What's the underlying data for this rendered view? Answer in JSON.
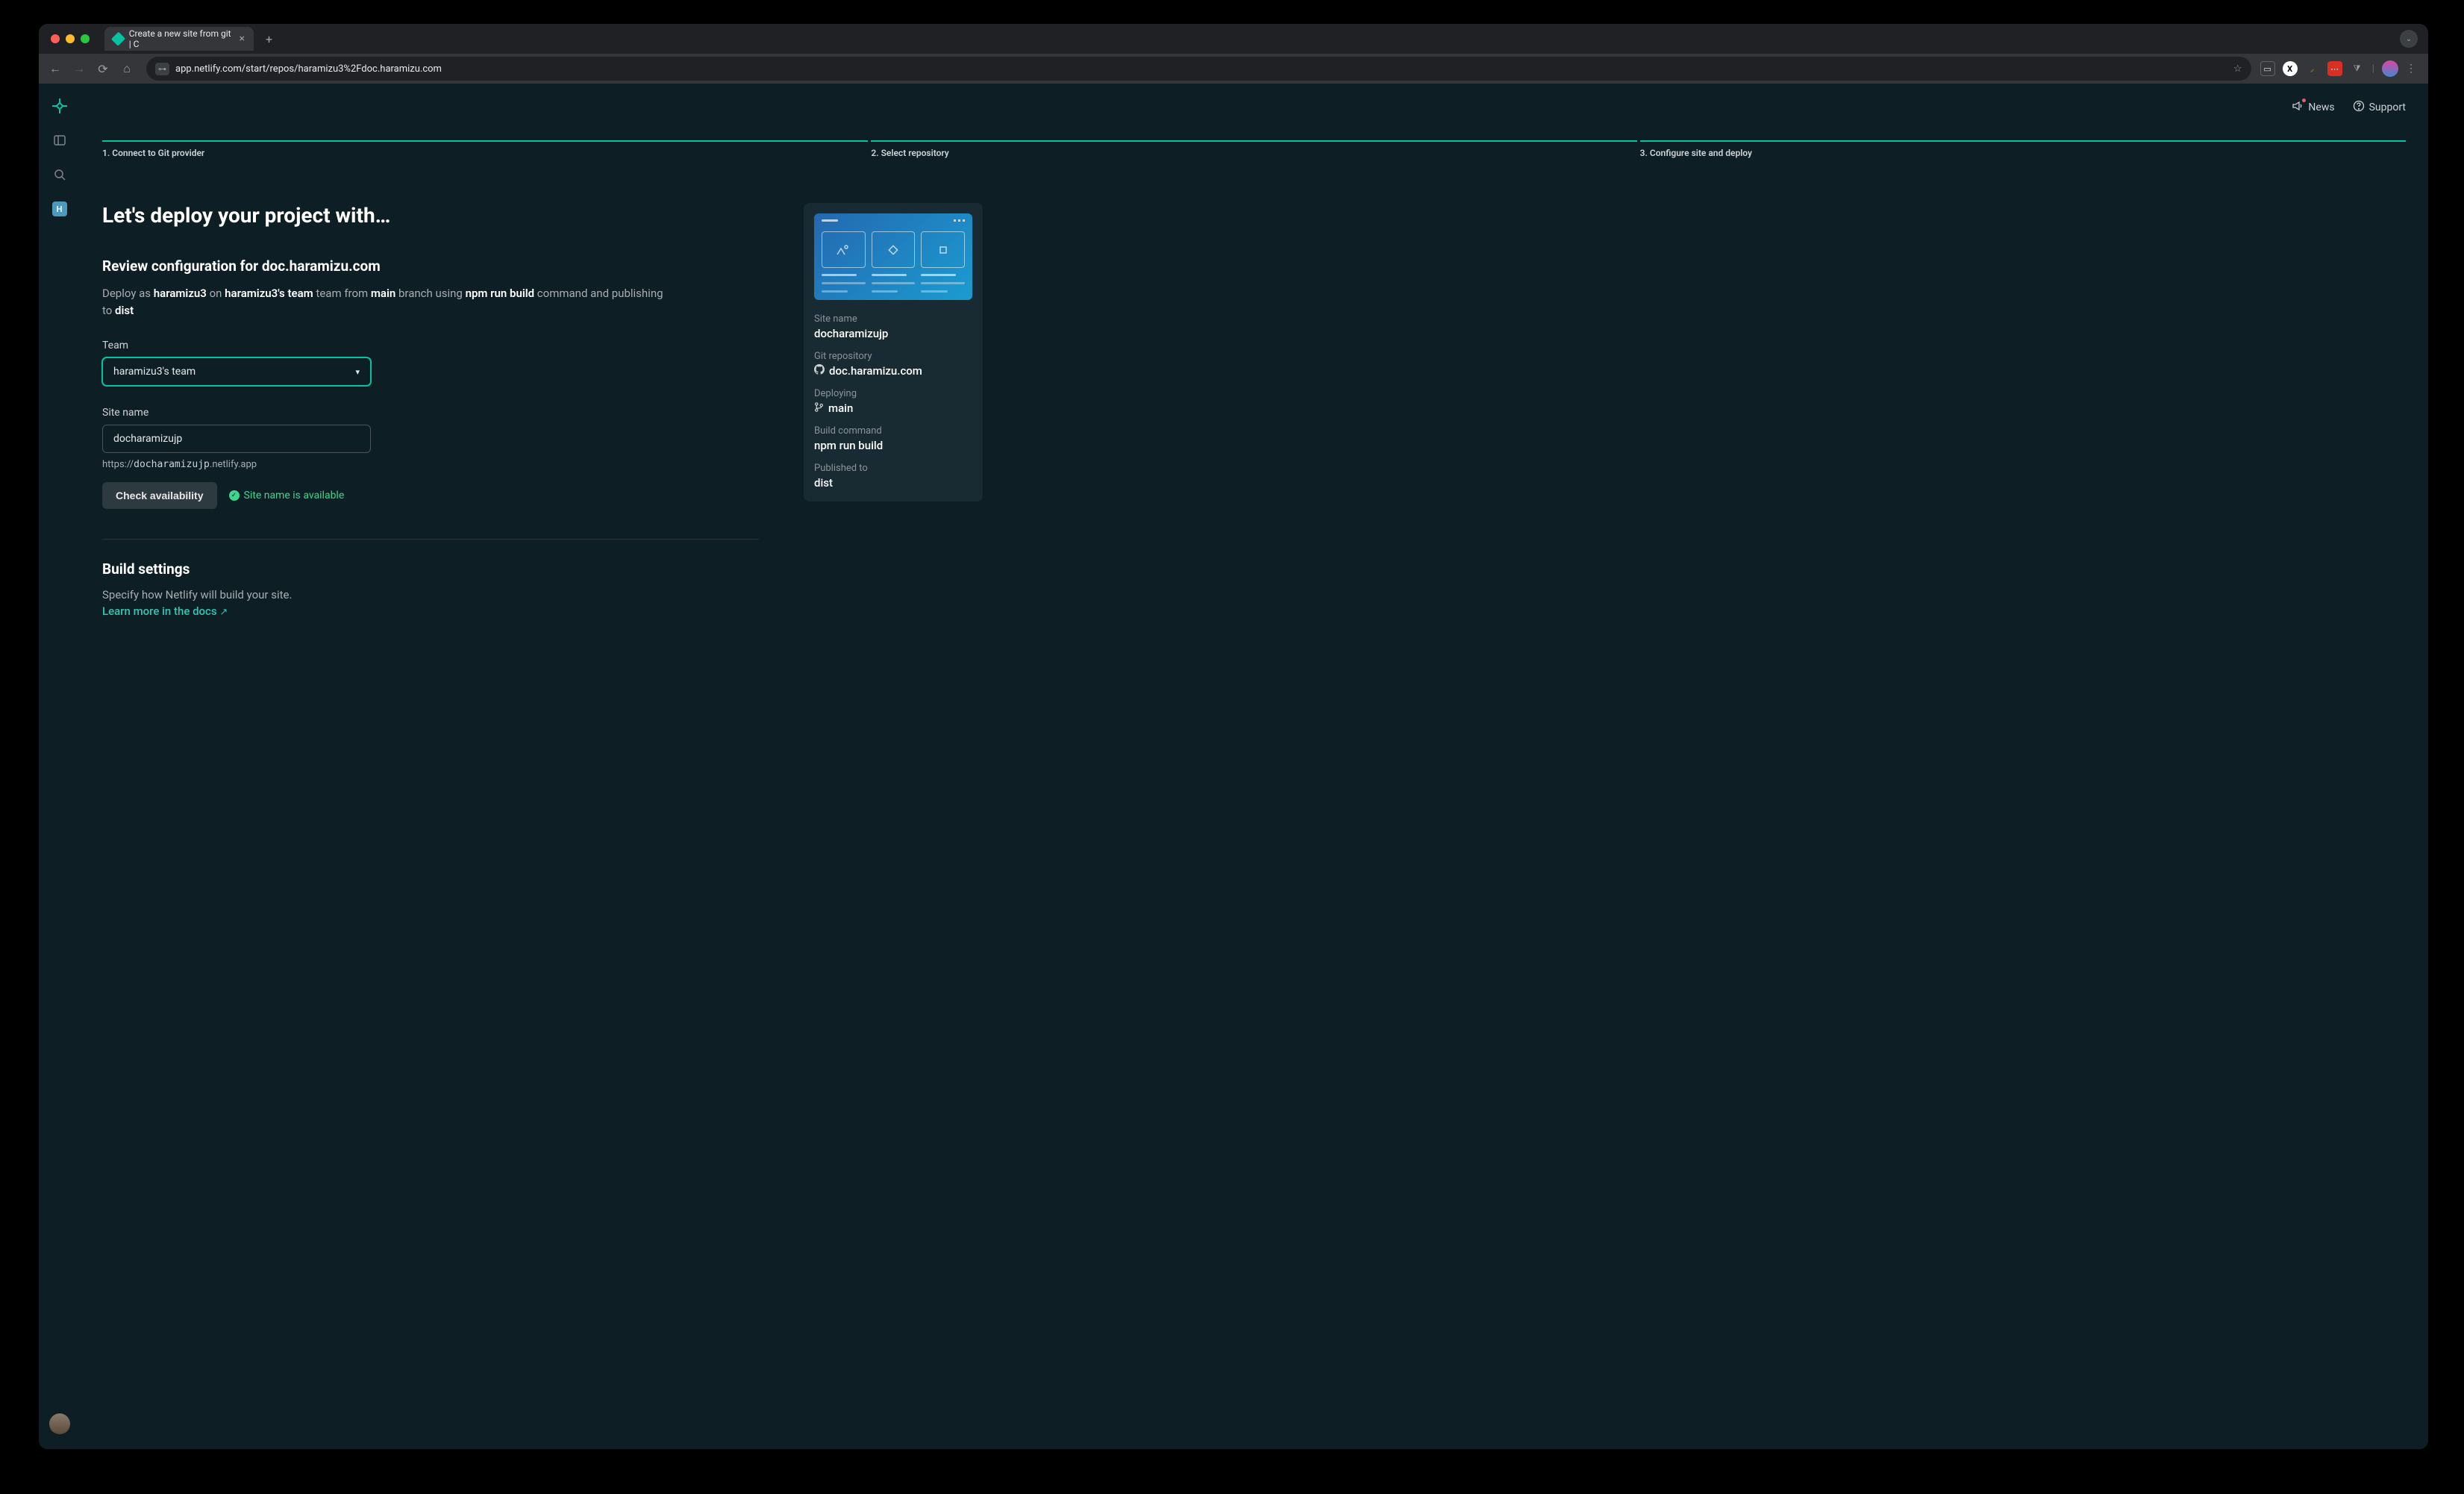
{
  "browser": {
    "tab_title": "Create a new site from git | C",
    "url": "app.netlify.com/start/repos/haramizu3%2Fdoc.haramizu.com"
  },
  "nav": {
    "news": "News",
    "support": "Support",
    "badge_letter": "H"
  },
  "steps": {
    "s1": "1. Connect to Git provider",
    "s2": "2. Select repository",
    "s3": "3. Configure site and deploy"
  },
  "page": {
    "title": "Let's deploy your project with…",
    "review_heading": "Review configuration for doc.haramizu.com",
    "deploy_pre": "Deploy as ",
    "deploy_user": "haramizu3",
    "deploy_on": " on ",
    "deploy_team": "haramizu3's team",
    "deploy_team_from": " team from ",
    "deploy_branch": "main",
    "deploy_branch_after": " branch using ",
    "deploy_cmd": "npm run build",
    "deploy_cmd_after": " command and publishing to ",
    "deploy_dir": "dist"
  },
  "form": {
    "team_label": "Team",
    "team_value": "haramizu3's team",
    "sitename_label": "Site name",
    "sitename_value": "docharamizujp",
    "url_prefix": "https://",
    "url_suffix": ".netlify.app",
    "check_btn": "Check availability",
    "available_text": "Site name is available"
  },
  "build": {
    "heading": "Build settings",
    "subtext": "Specify how Netlify will build your site.",
    "learn": "Learn more in the docs"
  },
  "summary": {
    "site_name_label": "Site name",
    "site_name": "docharamizujp",
    "git_label": "Git repository",
    "git_value": "doc.haramizu.com",
    "deploying_label": "Deploying",
    "deploying_value": "main",
    "build_cmd_label": "Build command",
    "build_cmd_value": "npm run build",
    "published_label": "Published to",
    "published_value": "dist"
  }
}
